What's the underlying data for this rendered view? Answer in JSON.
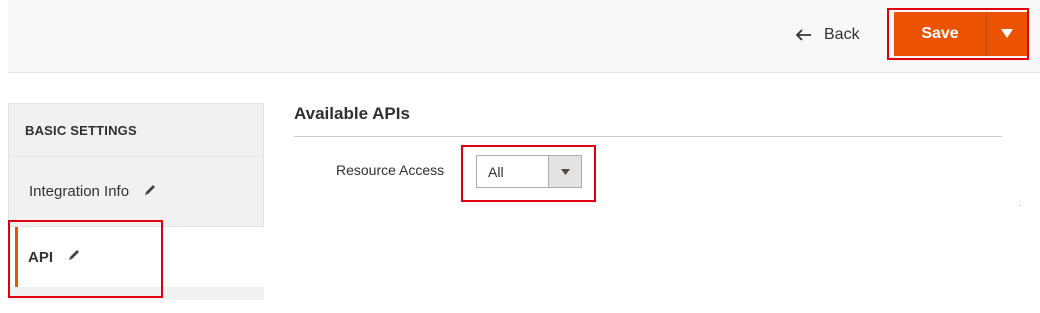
{
  "header": {
    "back_label": "Back",
    "save_label": "Save",
    "accent_color": "#eb5202",
    "highlight_color": "#e0000d"
  },
  "sidebar": {
    "title": "BASIC SETTINGS",
    "items": [
      {
        "label": "Integration Info",
        "icon": "pencil-icon",
        "active": false
      },
      {
        "label": "API",
        "icon": "pencil-icon",
        "active": true
      }
    ]
  },
  "main": {
    "section_title": "Available APIs",
    "resource_access": {
      "label": "Resource Access",
      "value": "All"
    }
  }
}
